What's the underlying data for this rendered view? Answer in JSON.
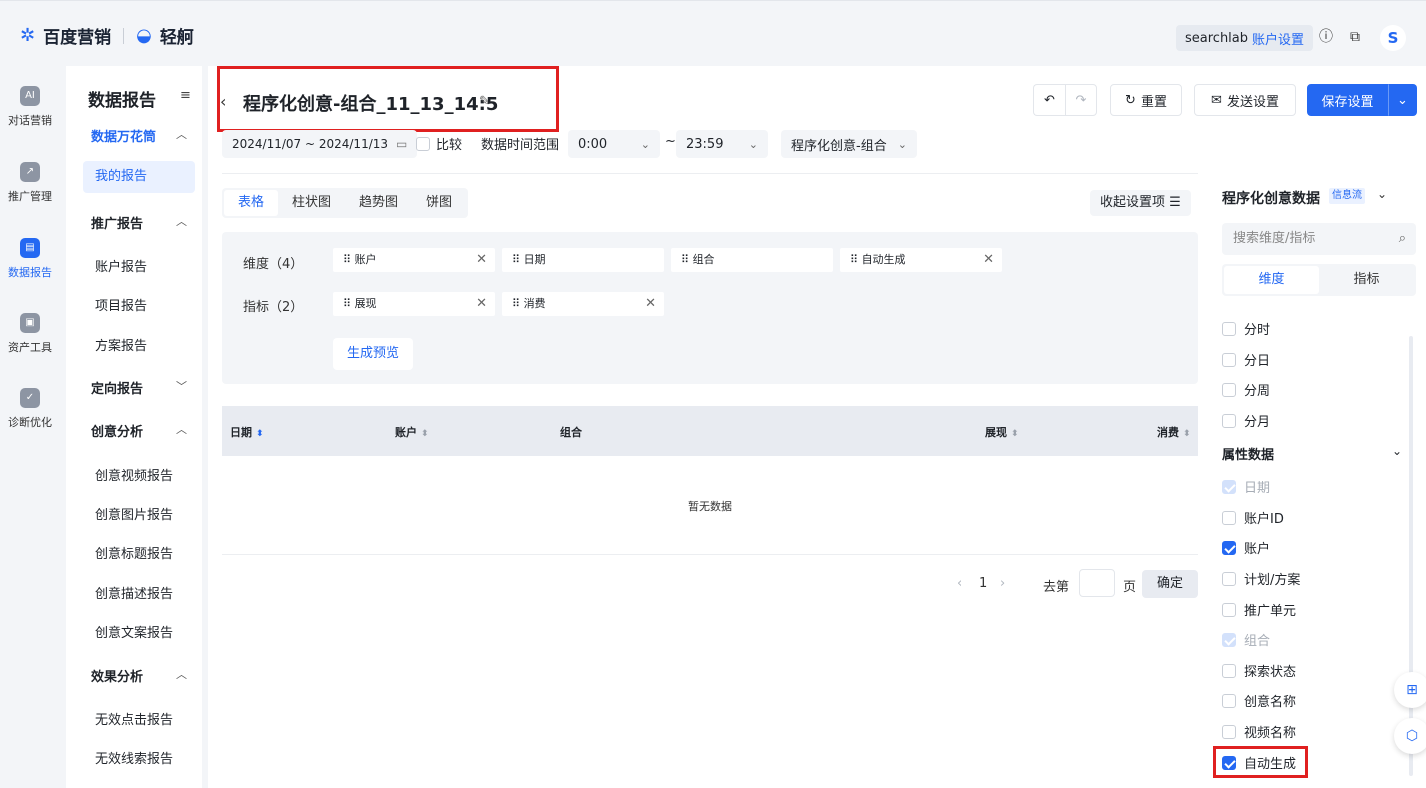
{
  "topbar": {
    "brand_main": "百度营销",
    "brand_sub": "轻舸",
    "account_name": "searchlab",
    "account_settings": "账户设置",
    "help_icon": "?",
    "avatar_letter": "S"
  },
  "leftnav": {
    "items": [
      {
        "label": "对话营销",
        "icon": "ai-icon"
      },
      {
        "label": "推广管理",
        "icon": "chart-icon"
      },
      {
        "label": "数据报告",
        "icon": "report-icon"
      },
      {
        "label": "资产工具",
        "icon": "briefcase-icon"
      },
      {
        "label": "诊断优化",
        "icon": "shield-icon"
      }
    ]
  },
  "sidebar": {
    "title": "数据报告",
    "toggle_icon": "≡",
    "groups": [
      {
        "label": "数据万花筒",
        "items": [
          "我的报告"
        ]
      },
      {
        "label": "推广报告",
        "items": [
          "账户报告",
          "项目报告",
          "方案报告"
        ]
      },
      {
        "label": "定向报告",
        "items": []
      },
      {
        "label": "创意分析",
        "items": [
          "创意视频报告",
          "创意图片报告",
          "创意标题报告",
          "创意描述报告",
          "创意文案报告"
        ]
      },
      {
        "label": "效果分析",
        "items": [
          "无效点击报告",
          "无效线索报告"
        ]
      }
    ]
  },
  "header": {
    "title": "程序化创意-组合_11_13_14:5",
    "reset": "重置",
    "send_settings": "发送设置",
    "save_settings": "保存设置"
  },
  "filters": {
    "date_range": "2024/11/07 ~ 2024/11/13",
    "compare": "比较",
    "time_range_label": "数据时间范围",
    "time_from": "0:00",
    "tilde": "~",
    "time_to": "23:59",
    "report_type": "程序化创意-组合"
  },
  "tabs": [
    "表格",
    "柱状图",
    "趋势图",
    "饼图"
  ],
  "collapse_label": "收起设置项",
  "config": {
    "dimension_label": "维度（4）",
    "dimensions": [
      "账户",
      "日期",
      "组合",
      "自动生成"
    ],
    "metric_label": "指标（2）",
    "metrics": [
      "展现",
      "消费"
    ],
    "preview_button": "生成预览"
  },
  "table": {
    "columns": [
      "日期",
      "账户",
      "组合",
      "展现",
      "消费"
    ],
    "empty": "暂无数据"
  },
  "pager": {
    "current": "1",
    "goto": "去第",
    "page": "页",
    "confirm": "确定"
  },
  "right_panel": {
    "title": "程序化创意数据",
    "tag": "信息流",
    "search_placeholder": "搜索维度/指标",
    "seg_dimension": "维度",
    "seg_metric": "指标",
    "time_options": [
      "分时",
      "分日",
      "分周",
      "分月"
    ],
    "attr_group": "属性数据",
    "attr_options": [
      {
        "label": "日期",
        "state": "disabled"
      },
      {
        "label": "账户ID",
        "state": "off"
      },
      {
        "label": "账户",
        "state": "on"
      },
      {
        "label": "计划/方案",
        "state": "off"
      },
      {
        "label": "推广单元",
        "state": "off"
      },
      {
        "label": "组合",
        "state": "disabled"
      },
      {
        "label": "探索状态",
        "state": "off"
      },
      {
        "label": "创意名称",
        "state": "off"
      },
      {
        "label": "视频名称",
        "state": "off"
      },
      {
        "label": "自动生成",
        "state": "on"
      }
    ]
  }
}
